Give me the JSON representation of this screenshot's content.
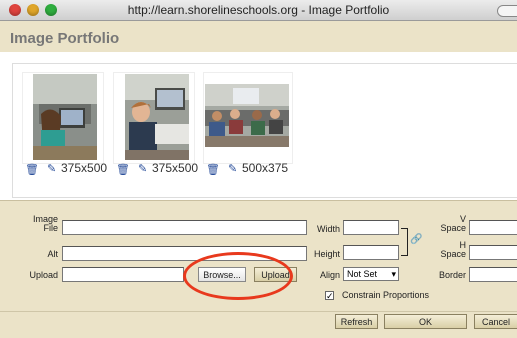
{
  "window": {
    "title": "http://learn.shorelineschools.org - Image Portfolio"
  },
  "header": {
    "title": "Image Portfolio"
  },
  "thumbnails": [
    {
      "size": "375x500",
      "delete_icon": "trash-icon",
      "edit_icon": "pencil-icon"
    },
    {
      "size": "375x500",
      "delete_icon": "trash-icon",
      "edit_icon": "pencil-icon"
    },
    {
      "size": "500x375",
      "delete_icon": "trash-icon",
      "edit_icon": "pencil-icon"
    }
  ],
  "form": {
    "image_file_label_1": "Image",
    "image_file_label_2": "File",
    "alt_label": "Alt",
    "upload_label": "Upload",
    "browse_button": "Browse...",
    "upload_button": "Upload",
    "width_label": "Width",
    "height_label": "Height",
    "align_label": "Align",
    "align_value": "Not Set",
    "vspace_label_1": "V",
    "vspace_label_2": "Space",
    "hspace_label_1": "H",
    "hspace_label_2": "Space",
    "border_label": "Border",
    "constrain_label": "Constrain Proportions",
    "constrain_checked": true
  },
  "buttons": {
    "refresh": "Refresh",
    "ok": "OK",
    "cancel": "Cancel"
  },
  "colors": {
    "panel_bg": "#ebe3c8",
    "highlight_circle": "#e8391d"
  }
}
